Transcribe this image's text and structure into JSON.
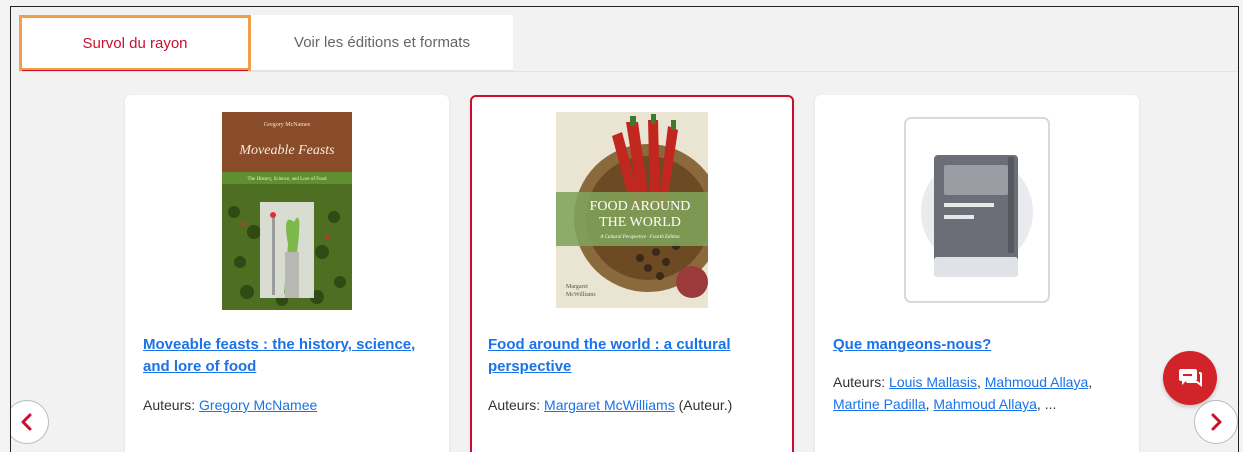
{
  "tabs": [
    {
      "label": "Survol du rayon",
      "active": true
    },
    {
      "label": "Voir les éditions et formats",
      "active": false
    }
  ],
  "colors": {
    "accent": "#c8102e",
    "link": "#1a73e8",
    "tab_focus": "#f0a04b"
  },
  "cards": [
    {
      "title": "Moveable feasts : the history, science, and lore of food",
      "authors_label": "Auteurs:",
      "authors": [
        "Gregory McNamee"
      ],
      "cover": {
        "author": "Gregory McNamee",
        "title": "Moveable Feasts",
        "subtitle": "The History, Science, and Lore of Food"
      }
    },
    {
      "title": "Food around the world : a cultural perspective",
      "authors_label": "Auteurs:",
      "authors": [
        "Margaret McWilliams"
      ],
      "authors_suffix": "(Auteur.)",
      "selected": true,
      "cover": {
        "title_line1": "FOOD AROUND",
        "title_line2": "THE WORLD",
        "subtitle": "A Cultural Perspective · Fourth Edition",
        "author_line1": "Margaret",
        "author_line2": "McWilliams"
      }
    },
    {
      "title": "Que mangeons-nous?",
      "authors_label": "Auteurs:",
      "authors": [
        "Louis Mallasis",
        "Mahmoud Allaya",
        "Martine Padilla",
        "Mahmoud Allaya"
      ],
      "authors_more": "...",
      "cover": {
        "placeholder_icon": "book-placeholder-icon"
      }
    }
  ],
  "nav": {
    "prev_icon": "chevron-left-icon",
    "next_icon": "chevron-right-icon"
  },
  "chat": {
    "icon": "chat-icon"
  }
}
